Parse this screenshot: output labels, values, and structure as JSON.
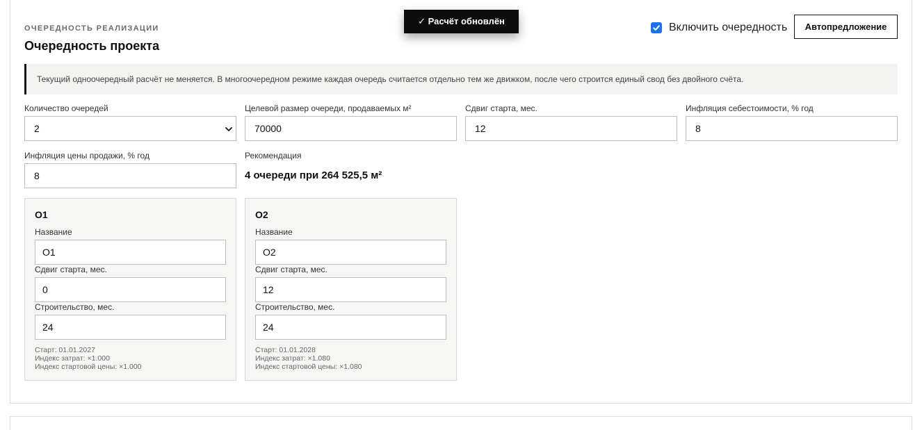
{
  "section": {
    "eyebrow": "ОЧЕРЕДНОСТЬ РЕАЛИЗАЦИИ",
    "title": "Очередность проекта"
  },
  "toast": {
    "text": "✓ Расчёт обновлён"
  },
  "toggle": {
    "label": "Включить очередность",
    "checked": true
  },
  "autosuggest_label": "Автопредложение",
  "note": "Текущий одноочередный расчёт не меняется. В многоочередном режиме каждая очередь считается отдельно тем же движком, после чего строится единый свод без двойного счёта.",
  "fields": {
    "queue_count": {
      "label": "Количество очередей",
      "value": "2"
    },
    "target_size": {
      "label": "Целевой размер очереди, продаваемых м²",
      "value": "70000"
    },
    "start_shift": {
      "label": "Сдвиг старта, мес.",
      "value": "12"
    },
    "cost_inflation": {
      "label": "Инфляция себестоимости, % год",
      "value": "8"
    },
    "price_inflation": {
      "label": "Инфляция цены продажи, % год",
      "value": "8"
    }
  },
  "recommendation": {
    "label": "Рекомендация",
    "value": "4 очереди при 264 525,5 м²"
  },
  "queues": [
    {
      "title": "О1",
      "name_label": "Название",
      "name_value": "О1",
      "shift_label": "Сдвиг старта, мес.",
      "shift_value": "0",
      "build_label": "Строительство, мес.",
      "build_value": "24",
      "start": "Старт: 01.01.2027",
      "cost_index": "Индекс затрат: ×1.000",
      "price_index": "Индекс стартовой цены: ×1.000"
    },
    {
      "title": "О2",
      "name_label": "Название",
      "name_value": "О2",
      "shift_label": "Сдвиг старта, мес.",
      "shift_value": "12",
      "build_label": "Строительство, мес.",
      "build_value": "24",
      "start": "Старт: 01.01.2028",
      "cost_index": "Индекс затрат: ×1.080",
      "price_index": "Индекс стартовой цены: ×1.080"
    }
  ],
  "colors": {
    "accent": "#1a73e8",
    "toast_bg": "#0d0d0d",
    "note_bg": "#f3f3f1",
    "card_bg": "#f6f6f4"
  }
}
